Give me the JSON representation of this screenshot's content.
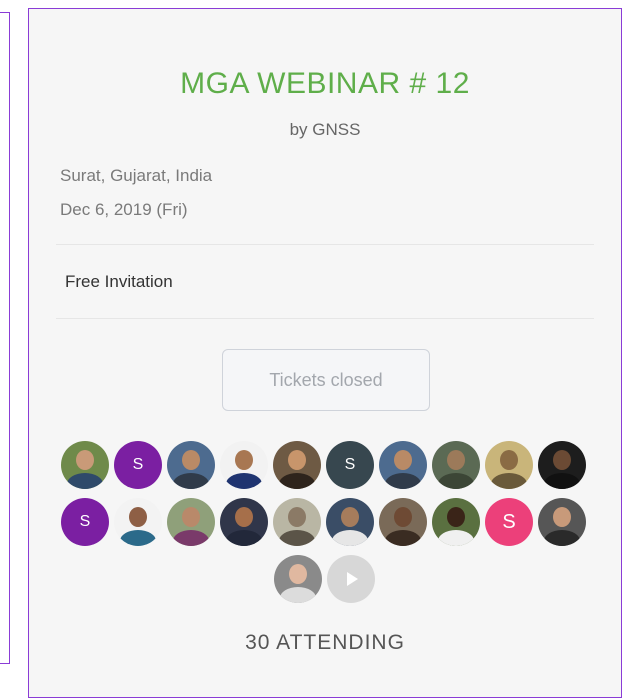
{
  "event": {
    "title": "MGA WEBINAR # 12",
    "organizer": "by GNSS",
    "location": "Surat, Gujarat, India",
    "date": "Dec 6, 2019 (Fri)",
    "ticket_type": "Free Invitation",
    "tickets_button": "Tickets closed",
    "attending_count": "30 ATTENDING"
  },
  "colors": {
    "accent_title": "#5fae4a",
    "frame": "#8a3cd6",
    "initial_purple": "#7b1fa2",
    "initial_slate": "#37474f",
    "initial_pink": "#ec407a"
  },
  "attendees": [
    {
      "kind": "photo",
      "bg": "#6f8a4a",
      "face": "#c99a78",
      "body": "#2f4a6a"
    },
    {
      "kind": "initial",
      "label": "S",
      "bg": "#7b1fa2"
    },
    {
      "kind": "photo",
      "bg": "#4d6b8f",
      "face": "#b98a66",
      "body": "#303b4a"
    },
    {
      "kind": "photo",
      "bg": "#f2f2f2",
      "face": "#a87752",
      "body": "#1f3470"
    },
    {
      "kind": "photo",
      "bg": "#6e5a44",
      "face": "#c8956b",
      "body": "#2e241c"
    },
    {
      "kind": "initial",
      "label": "S",
      "bg": "#37474f"
    },
    {
      "kind": "photo",
      "bg": "#4d6b8f",
      "face": "#b98a66",
      "body": "#303b4a"
    },
    {
      "kind": "photo",
      "bg": "#5b6a54",
      "face": "#9c7a5a",
      "body": "#3c4636"
    },
    {
      "kind": "photo",
      "bg": "#c9b57a",
      "face": "#8a6b44",
      "body": "#6a5a3a"
    },
    {
      "kind": "photo",
      "bg": "#1d1d1d",
      "face": "#6b4a34",
      "body": "#111111"
    },
    {
      "kind": "initial",
      "label": "S",
      "bg": "#7b1fa2"
    },
    {
      "kind": "photo",
      "bg": "#f3f3f3",
      "face": "#8e5f45",
      "body": "#2b6a8a"
    },
    {
      "kind": "photo",
      "bg": "#8fa07a",
      "face": "#b9896a",
      "body": "#7a3a6a"
    },
    {
      "kind": "photo",
      "bg": "#30364a",
      "face": "#a66f4a",
      "body": "#22283a"
    },
    {
      "kind": "photo",
      "bg": "#b9b6a4",
      "face": "#8b7a66",
      "body": "#5b5448"
    },
    {
      "kind": "photo",
      "bg": "#3a4d66",
      "face": "#a67c5c",
      "body": "#e6e6e6"
    },
    {
      "kind": "photo",
      "bg": "#7a6a58",
      "face": "#6e4a34",
      "body": "#3a2c22"
    },
    {
      "kind": "photo",
      "bg": "#5a7040",
      "face": "#3a2418",
      "body": "#f0f0f0"
    },
    {
      "kind": "initial",
      "label": "S",
      "bg": "#ec407a"
    },
    {
      "kind": "photo",
      "bg": "#565656",
      "face": "#c89a7a",
      "body": "#2a2a2a"
    },
    {
      "kind": "photo",
      "bg": "#8a8a8a",
      "face": "#e0b8a0",
      "body": "#dcdcdc"
    },
    {
      "kind": "play"
    }
  ]
}
